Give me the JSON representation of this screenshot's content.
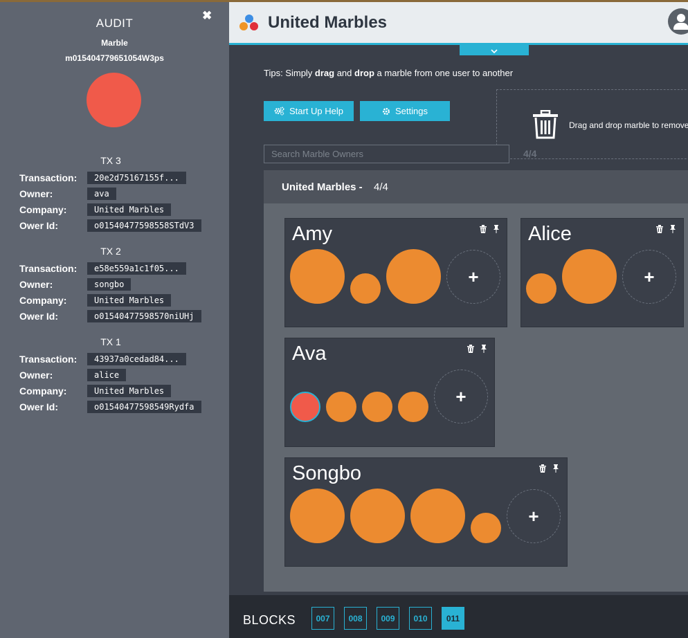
{
  "audit": {
    "title": "AUDIT",
    "close_icon": "close-icon",
    "marble_label": "Marble",
    "marble_id": "m015404779651054W3ps",
    "marble_color": "#f05a4a",
    "transactions": [
      {
        "title": "TX 3",
        "transaction": "20e2d75167155f...",
        "owner": "ava",
        "company": "United Marbles",
        "owner_id": "o01540477598558STdV3"
      },
      {
        "title": "TX 2",
        "transaction": "e58e559a1c1f05...",
        "owner": "songbo",
        "company": "United Marbles",
        "owner_id": "o01540477598570niUHj"
      },
      {
        "title": "TX 1",
        "transaction": "43937a0cedad84...",
        "owner": "alice",
        "company": "United Marbles",
        "owner_id": "o01540477598549Rydfa"
      }
    ],
    "labels": {
      "transaction": "Transaction:",
      "owner": "Owner:",
      "company": "Company:",
      "owner_id": "Ower Id:"
    }
  },
  "header": {
    "app_title": "United Marbles",
    "accent_color": "#29b2d4"
  },
  "tips": {
    "prefix": "Tips: Simply ",
    "drag": "drag",
    "and": " and ",
    "drop": "drop",
    "suffix": " a marble from one user to another"
  },
  "buttons": {
    "startup_help": "Start Up Help",
    "settings": "Settings"
  },
  "trash": {
    "text": "Drag and drop marble to remove"
  },
  "search": {
    "placeholder": "Search Marble Owners",
    "count": "4/4"
  },
  "company": {
    "name": "United Marbles -",
    "count": "4/4"
  },
  "users": [
    {
      "name": "Amy"
    },
    {
      "name": "Alice"
    },
    {
      "name": "Ava"
    },
    {
      "name": "Songbo"
    }
  ],
  "blocks": {
    "label": "BLOCKS",
    "items": [
      "007",
      "008",
      "009",
      "010",
      "011"
    ],
    "active": "011"
  }
}
